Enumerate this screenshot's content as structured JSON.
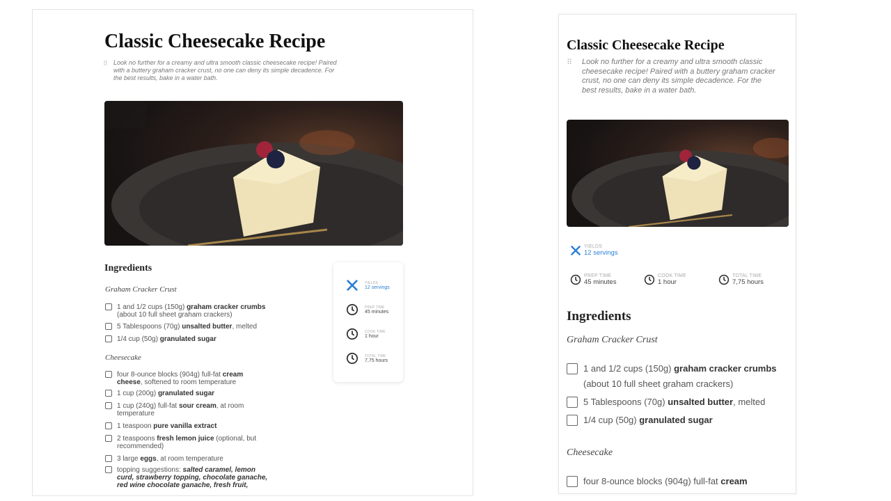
{
  "recipe": {
    "title": "Classic Cheesecake Recipe",
    "intro": "Look no further for a creamy and ultra smooth classic cheesecake recipe! Paired with a buttery graham cracker crust, no one can deny its simple decadence. For the best results, bake in a water bath.",
    "ingredients_heading": "Ingredients",
    "sections": [
      {
        "name": "Graham Cracker Crust",
        "items": [
          {
            "pre": "1 and 1/2 cups (150g) ",
            "bold": "graham cracker crumbs",
            "post": " (about 10 full sheet graham crackers)"
          },
          {
            "pre": "5 Tablespoons (70g) ",
            "bold": "unsalted butter",
            "post": ", melted"
          },
          {
            "pre": "1/4 cup (50g) ",
            "bold": "granulated sugar",
            "post": ""
          }
        ]
      },
      {
        "name": "Cheesecake",
        "items": [
          {
            "pre": "four 8-ounce blocks (904g) full-fat ",
            "bold": "cream cheese",
            "post": ", softened to room temperature"
          },
          {
            "pre": "1 cup (200g) ",
            "bold": "granulated sugar",
            "post": ""
          },
          {
            "pre": "1 cup (240g) full-fat ",
            "bold": "sour cream",
            "post": ", at room temperature"
          },
          {
            "pre": "1 teaspoon ",
            "bold": "pure vanilla extract",
            "post": ""
          },
          {
            "pre": "2 teaspoons ",
            "bold": "fresh lemon juice",
            "post": " (optional, but recommended)"
          },
          {
            "pre": "3 large ",
            "bold": "eggs",
            "post": ", at room temperature"
          },
          {
            "pre": "topping suggestions: ",
            "italic": "salted caramel, lemon curd, strawberry topping, chocolate ganache, red wine chocolate ganache, fresh fruit,",
            "post": ""
          }
        ]
      }
    ],
    "mobile_visible_cheesecake_item": {
      "pre": "four 8-ounce blocks (904g) full-fat ",
      "bold": "cream"
    }
  },
  "meta": {
    "yields_label": "YIELDS",
    "yields_value": "12 servings",
    "prep_label": "PREP TIME",
    "prep_value": "45 minutes",
    "cook_label": "COOK TIME",
    "cook_value": "1 hour",
    "total_label": "TOTAL TIME",
    "total_value": "7,75 hours",
    "accent_color": "#2b7fd4"
  },
  "icons": {
    "yields": "utensils-icon",
    "time": "clock-icon",
    "drag": "drag-handle-icon"
  }
}
